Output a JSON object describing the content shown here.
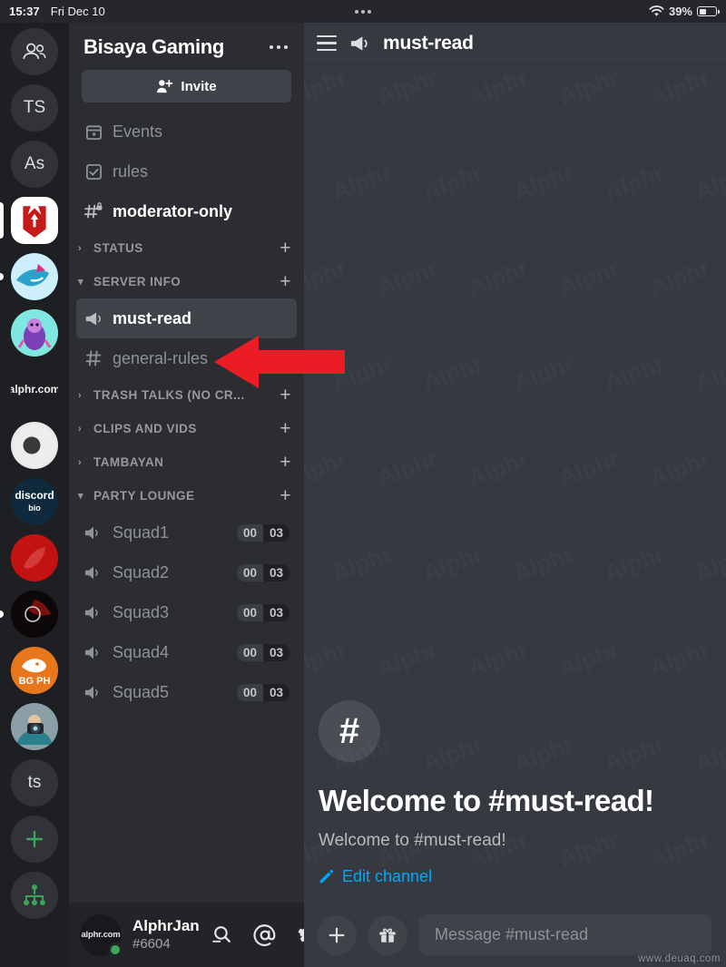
{
  "status_bar": {
    "time": "15:37",
    "date": "Fri Dec 10",
    "battery_percent": "39%",
    "wifi_icon": "wifi-icon",
    "battery_icon": "battery-icon",
    "dots_icon": "recording-dots-icon"
  },
  "server_rail": {
    "items": [
      {
        "name": "friends-home",
        "label": "",
        "icon": "people-icon",
        "shape": "circle",
        "indicator": "none",
        "bg": "#313338"
      },
      {
        "name": "server-ts",
        "label": "TS",
        "icon": "",
        "shape": "circle",
        "indicator": "none",
        "bg": "#313338"
      },
      {
        "name": "server-as",
        "label": "As",
        "icon": "",
        "shape": "circle",
        "indicator": "none",
        "bg": "#313338"
      },
      {
        "name": "server-bisaya-gaming",
        "label": "",
        "icon": "red-banner-icon",
        "shape": "squircle",
        "indicator": "active",
        "bg": "#ffffff"
      },
      {
        "name": "server-shark",
        "label": "",
        "icon": "shark-avatar",
        "shape": "circle",
        "indicator": "unread",
        "bg": "#1ca3d6"
      },
      {
        "name": "server-purple-character",
        "label": "",
        "icon": "character-avatar",
        "shape": "circle",
        "indicator": "none",
        "bg": "#7ee8e0"
      },
      {
        "name": "server-alphr",
        "label": "alphr.com",
        "icon": "",
        "shape": "circle",
        "indicator": "none",
        "bg": "#1e1f22"
      },
      {
        "name": "server-a-logo",
        "label": "",
        "icon": "a-logo-icon",
        "shape": "circle",
        "indicator": "none",
        "bg": "#e9e9e9"
      },
      {
        "name": "server-discord-bio",
        "label": "discord bio",
        "icon": "",
        "shape": "circle",
        "indicator": "none",
        "bg": "#0e2a3c"
      },
      {
        "name": "server-red-avatar",
        "label": "",
        "icon": "red-avatar",
        "shape": "circle",
        "indicator": "none",
        "bg": "#c01010"
      },
      {
        "name": "server-dark-splatter",
        "label": "",
        "icon": "splatter-avatar",
        "shape": "circle",
        "indicator": "unread",
        "bg": "#120a0a"
      },
      {
        "name": "server-bgph",
        "label": "BG PH",
        "icon": "rooster-icon",
        "shape": "circle",
        "indicator": "none",
        "bg": "#e8761b"
      },
      {
        "name": "server-photographer",
        "label": "",
        "icon": "photographer-avatar",
        "shape": "circle",
        "indicator": "none",
        "bg": "#6d8a93"
      },
      {
        "name": "server-ts-lower",
        "label": "ts",
        "icon": "",
        "shape": "circle",
        "indicator": "none",
        "bg": "#313338"
      },
      {
        "name": "add-server",
        "label": "+",
        "icon": "plus-icon",
        "shape": "circle",
        "indicator": "none",
        "bg": "#313338"
      },
      {
        "name": "explore-servers",
        "label": "",
        "icon": "explore-compass-icon",
        "shape": "circle",
        "indicator": "none",
        "bg": "#313338"
      }
    ]
  },
  "sidebar": {
    "server_name": "Bisaya Gaming",
    "overflow_label": "server-options",
    "invite_label": "Invite",
    "invite_icon": "person-add-icon",
    "entries": [
      {
        "kind": "channel",
        "name": "events",
        "label": "Events",
        "icon": "calendar-icon",
        "state": "read"
      },
      {
        "kind": "channel",
        "name": "rules",
        "label": "rules",
        "icon": "checkbox-icon",
        "state": "read"
      },
      {
        "kind": "channel",
        "name": "moderator-only",
        "label": "moderator-only",
        "icon": "hash-lock-icon",
        "state": "unread"
      },
      {
        "kind": "category",
        "name": "status",
        "label": "STATUS",
        "chevron": "right",
        "plus": "+"
      },
      {
        "kind": "category",
        "name": "server-info",
        "label": "SERVER INFO",
        "chevron": "down",
        "plus": "+"
      },
      {
        "kind": "channel",
        "name": "must-read",
        "label": "must-read",
        "icon": "announcement-icon",
        "state": "active"
      },
      {
        "kind": "channel",
        "name": "general-rules",
        "label": "general-rules",
        "icon": "hash-icon",
        "state": "read"
      },
      {
        "kind": "category",
        "name": "trash-talks",
        "label": "TRASH TALKS (NO CR...",
        "chevron": "right",
        "plus": "+"
      },
      {
        "kind": "category",
        "name": "clips-and-vids",
        "label": "CLIPS AND VIDS",
        "chevron": "right",
        "plus": "+"
      },
      {
        "kind": "category",
        "name": "tambayan",
        "label": "TAMBAYAN",
        "chevron": "right",
        "plus": "+"
      },
      {
        "kind": "category",
        "name": "party-lounge",
        "label": "PARTY LOUNGE",
        "chevron": "down",
        "plus": "+"
      },
      {
        "kind": "voice",
        "name": "squad1",
        "label": "Squad1",
        "icon": "speaker-icon",
        "occupied": "00",
        "limit": "03"
      },
      {
        "kind": "voice",
        "name": "squad2",
        "label": "Squad2",
        "icon": "speaker-icon",
        "occupied": "00",
        "limit": "03"
      },
      {
        "kind": "voice",
        "name": "squad3",
        "label": "Squad3",
        "icon": "speaker-icon",
        "occupied": "00",
        "limit": "03"
      },
      {
        "kind": "voice",
        "name": "squad4",
        "label": "Squad4",
        "icon": "speaker-icon",
        "occupied": "00",
        "limit": "03"
      },
      {
        "kind": "voice",
        "name": "squad5",
        "label": "Squad5",
        "icon": "speaker-icon",
        "occupied": "00",
        "limit": "03"
      }
    ]
  },
  "user_bar": {
    "avatar_label": "alphr.com",
    "username": "AlphrJan",
    "discriminator": "#6604",
    "presence": "online",
    "presence_color": "#3ba55c",
    "actions": [
      {
        "name": "search-icon",
        "glyph": "search"
      },
      {
        "name": "mentions-icon",
        "glyph": "at"
      },
      {
        "name": "settings-gear-icon",
        "glyph": "gear"
      }
    ]
  },
  "chat": {
    "menu_icon": "hamburger-menu-icon",
    "channel_icon": "announcement-icon",
    "channel_title": "must-read",
    "welcome": {
      "avatar_glyph": "#",
      "title": "Welcome to #must-read!",
      "subtitle": "Welcome to #must-read!",
      "edit_label": "Edit channel",
      "edit_icon": "pencil-icon",
      "edit_color": "#00a8fc"
    },
    "composer": {
      "add_icon": "plus-icon",
      "gift_icon": "gift-icon",
      "placeholder": "Message #must-read"
    }
  },
  "annotation": {
    "arrow_name": "red-pointer-arrow",
    "arrow_color": "#ec1c24",
    "points_to": "must-read"
  },
  "watermark": {
    "tiled_text": "Alphr",
    "site_text": "www.deuaq.com"
  }
}
